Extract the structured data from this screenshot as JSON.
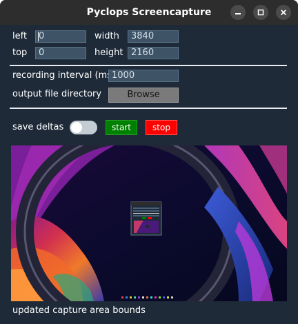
{
  "window": {
    "title": "Pyclops Screencapture",
    "controls": [
      "minimize-icon",
      "maximize-icon",
      "close-icon"
    ]
  },
  "capture_area": {
    "left_label": "left",
    "left_value": "0",
    "width_label": "width",
    "width_value": "3840",
    "top_label": "top",
    "top_value": "0",
    "height_label": "height",
    "height_value": "2160"
  },
  "settings": {
    "interval_label": "recording interval (ms)",
    "interval_value": "1000",
    "output_label": "output file directory",
    "browse_label": "Browse"
  },
  "controls": {
    "save_deltas_label": "save deltas",
    "save_deltas_on": false,
    "start_label": "start",
    "stop_label": "stop",
    "start_color": "#008000",
    "stop_color": "#ff0000"
  },
  "status": {
    "message": "updated capture area bounds"
  },
  "colors": {
    "window_bg": "#1e2a38",
    "titlebar_bg": "#2d2d2d",
    "input_bg": "#3e5366"
  }
}
